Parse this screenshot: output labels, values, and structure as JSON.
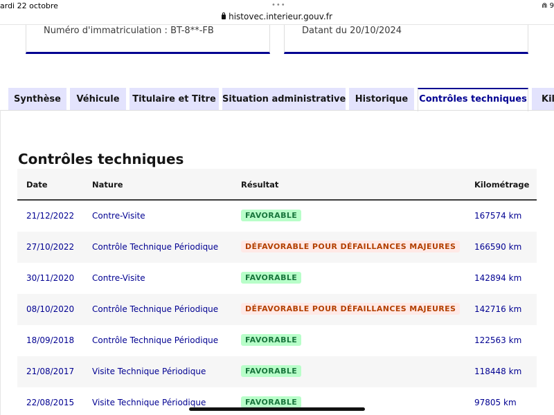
{
  "status_bar": {
    "date": "ardi 22 octobre",
    "dots": "•••",
    "url": "histovec.interieur.gouv.fr",
    "icons": "⋒ 9"
  },
  "cards": {
    "left": "Numéro d'immatriculation : BT-8**-FB",
    "right": "Datant du 20/10/2024"
  },
  "tabs": [
    {
      "label": "Synthèse",
      "active": false
    },
    {
      "label": "Véhicule",
      "active": false
    },
    {
      "label": "Titulaire et Titre",
      "active": false
    },
    {
      "label": "Situation administrative",
      "active": false
    },
    {
      "label": "Historique",
      "active": false
    },
    {
      "label": "Contrôles techniques",
      "active": true
    },
    {
      "label": "Kilo",
      "active": false
    }
  ],
  "section": {
    "title": "Contrôles techniques"
  },
  "table": {
    "headers": {
      "date": "Date",
      "nature": "Nature",
      "result": "Résultat",
      "km": "Kilométrage"
    },
    "rows": [
      {
        "date": "21/12/2022",
        "nature": "Contre-Visite",
        "result": "FAVORABLE",
        "ok": true,
        "km": "167574 km"
      },
      {
        "date": "27/10/2022",
        "nature": "Contrôle Technique Périodique",
        "result": "DÉFAVORABLE POUR DÉFAILLANCES MAJEURES",
        "ok": false,
        "km": "166590 km"
      },
      {
        "date": "30/11/2020",
        "nature": "Contre-Visite",
        "result": "FAVORABLE",
        "ok": true,
        "km": "142894 km"
      },
      {
        "date": "08/10/2020",
        "nature": "Contrôle Technique Périodique",
        "result": "DÉFAVORABLE POUR DÉFAILLANCES MAJEURES",
        "ok": false,
        "km": "142716 km"
      },
      {
        "date": "18/09/2018",
        "nature": "Contrôle Technique Périodique",
        "result": "FAVORABLE",
        "ok": true,
        "km": "122563 km"
      },
      {
        "date": "21/08/2017",
        "nature": "Visite Technique Périodique",
        "result": "FAVORABLE",
        "ok": true,
        "km": "118448 km"
      },
      {
        "date": "22/08/2015",
        "nature": "Visite Technique Périodique",
        "result": "FAVORABLE",
        "ok": true,
        "km": "97805 km"
      }
    ]
  },
  "colors": {
    "accent": "#000091",
    "tab_bg": "#e3e3fd",
    "favorable_bg": "#b8fec9",
    "favorable_text": "#18753c",
    "defavorable_bg": "#ffe9e6",
    "defavorable_text": "#b34000"
  }
}
